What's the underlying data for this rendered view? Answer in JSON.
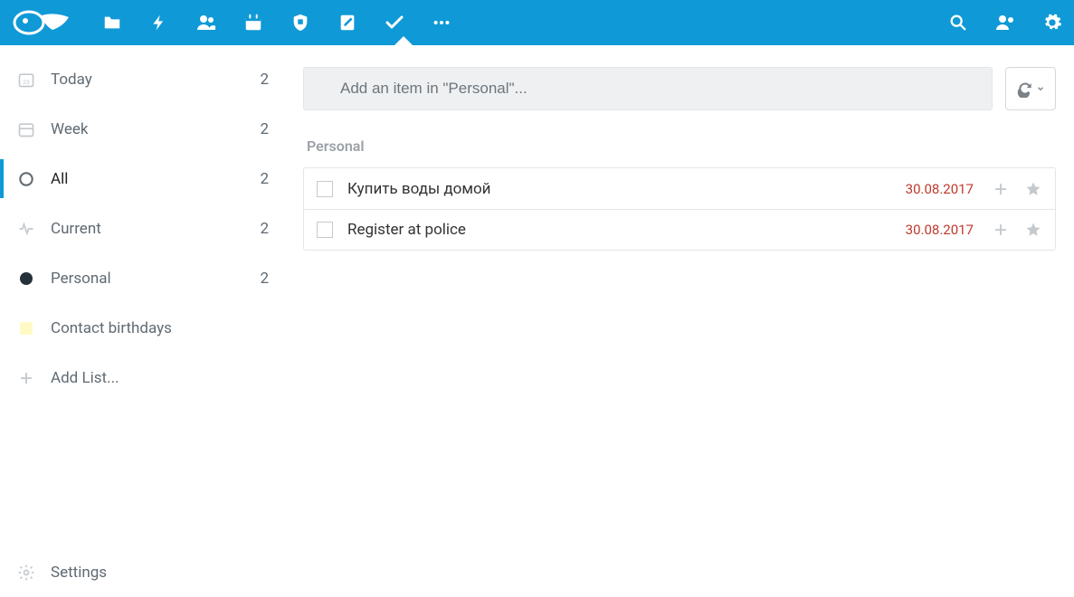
{
  "topbar": {
    "icons_left": [
      "logo",
      "folder",
      "bolt",
      "group",
      "calendar",
      "puzzle",
      "note",
      "check",
      "more"
    ],
    "icons_right": [
      "search",
      "users",
      "gear"
    ]
  },
  "sidebar": {
    "items": [
      {
        "icon": "cal-day",
        "label": "Today",
        "count": "2"
      },
      {
        "icon": "cal-week",
        "label": "Week",
        "count": "2"
      },
      {
        "icon": "circle-open",
        "label": "All",
        "count": "2",
        "active": true
      },
      {
        "icon": "pulse",
        "label": "Current",
        "count": "2"
      },
      {
        "icon": "dot-dark",
        "label": "Personal",
        "count": "2"
      },
      {
        "icon": "dot-yellow",
        "label": "Contact birthdays",
        "count": ""
      },
      {
        "icon": "plus",
        "label": "Add List...",
        "count": ""
      }
    ],
    "settings_label": "Settings"
  },
  "main": {
    "add_placeholder": "Add an item in \"Personal\"...",
    "section_title": "Personal",
    "tasks": [
      {
        "title": "Купить воды домой",
        "date": "30.08.2017"
      },
      {
        "title": "Register at police",
        "date": "30.08.2017"
      }
    ]
  }
}
